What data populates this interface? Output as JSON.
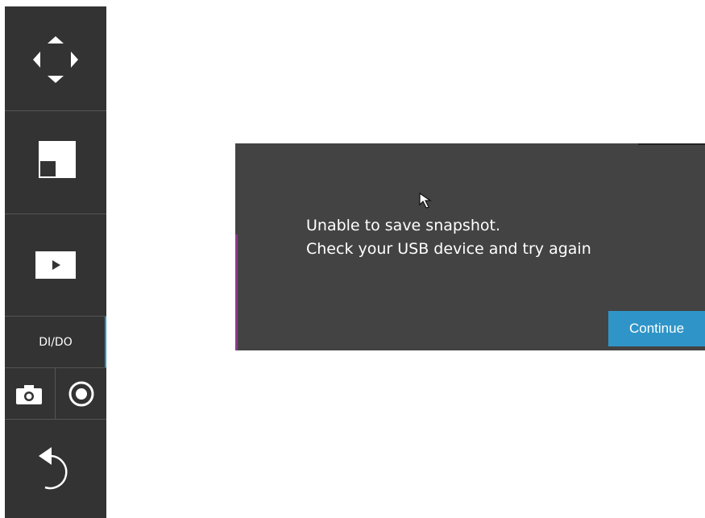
{
  "sidebar": {
    "ptz_icon": "move-arrows-icon",
    "window_icon": "window-layout-icon",
    "play_icon": "play-icon",
    "dido_label": "DI/DO",
    "snapshot_icon": "camera-icon",
    "record_icon": "record-icon",
    "back_icon": "undo-arrow-icon"
  },
  "dialog": {
    "line1": "Unable to save snapshot.",
    "line2": "Check your USB device and try again",
    "continue_label": "Continue"
  },
  "colors": {
    "sidebar_bg": "#333333",
    "dialog_bg": "#434343",
    "accent_blue": "#2f95c8",
    "accent_purple": "#8a3a8a"
  }
}
